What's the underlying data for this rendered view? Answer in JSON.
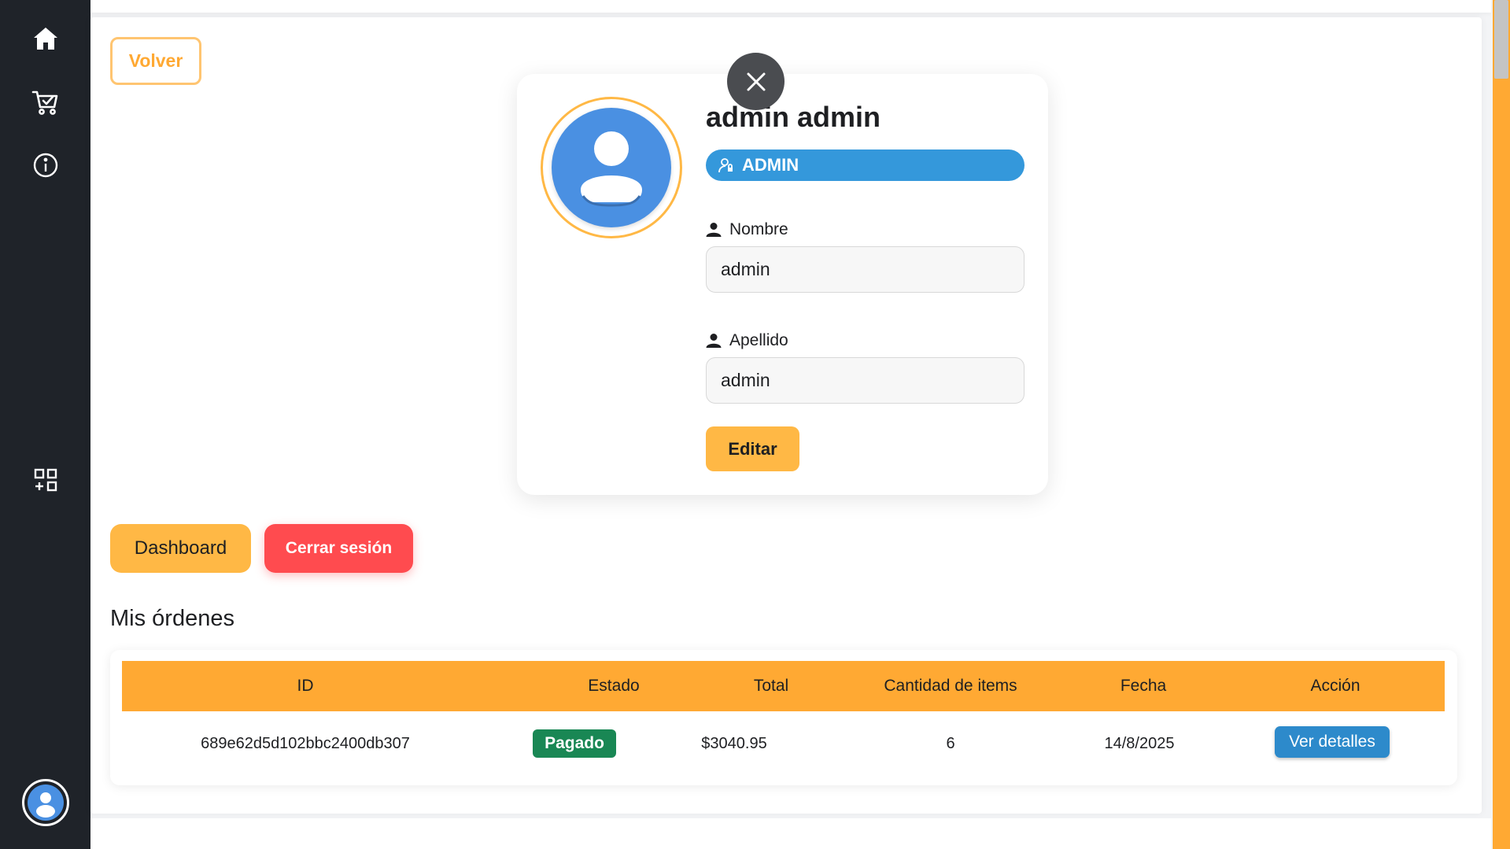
{
  "sidebar": {
    "items": [
      {
        "icon": "home-icon"
      },
      {
        "icon": "cart-check-icon"
      },
      {
        "icon": "info-icon"
      },
      {
        "icon": "grid-add-icon"
      }
    ],
    "avatar_icon": "user-avatar-icon"
  },
  "nav": {
    "back_label": "Volver"
  },
  "profile": {
    "full_name": "admin admin",
    "role": "ADMIN",
    "first_name_label": "Nombre",
    "first_name_value": "admin",
    "last_name_label": "Apellido",
    "last_name_value": "admin",
    "edit_label": "Editar"
  },
  "actions": {
    "dashboard_label": "Dashboard",
    "logout_label": "Cerrar sesión"
  },
  "orders": {
    "title": "Mis órdenes",
    "columns": [
      "ID",
      "Estado",
      "Total",
      "Cantidad de items",
      "Fecha",
      "Acción"
    ],
    "rows": [
      {
        "id": "689e62d5d102bbc2400db307",
        "status": "Pagado",
        "total": "$3040.95",
        "items": "6",
        "date": "14/8/2025",
        "action": "Ver detalles"
      }
    ]
  },
  "colors": {
    "sidebar": "#1f2329",
    "accent_orange": "#ffa933",
    "button_orange": "#ffb845",
    "role_blue": "#3498db",
    "avatar_blue": "#4a90e2",
    "logout_red": "#ff4b4f",
    "status_green": "#198754",
    "details_blue": "#2d8acb"
  }
}
